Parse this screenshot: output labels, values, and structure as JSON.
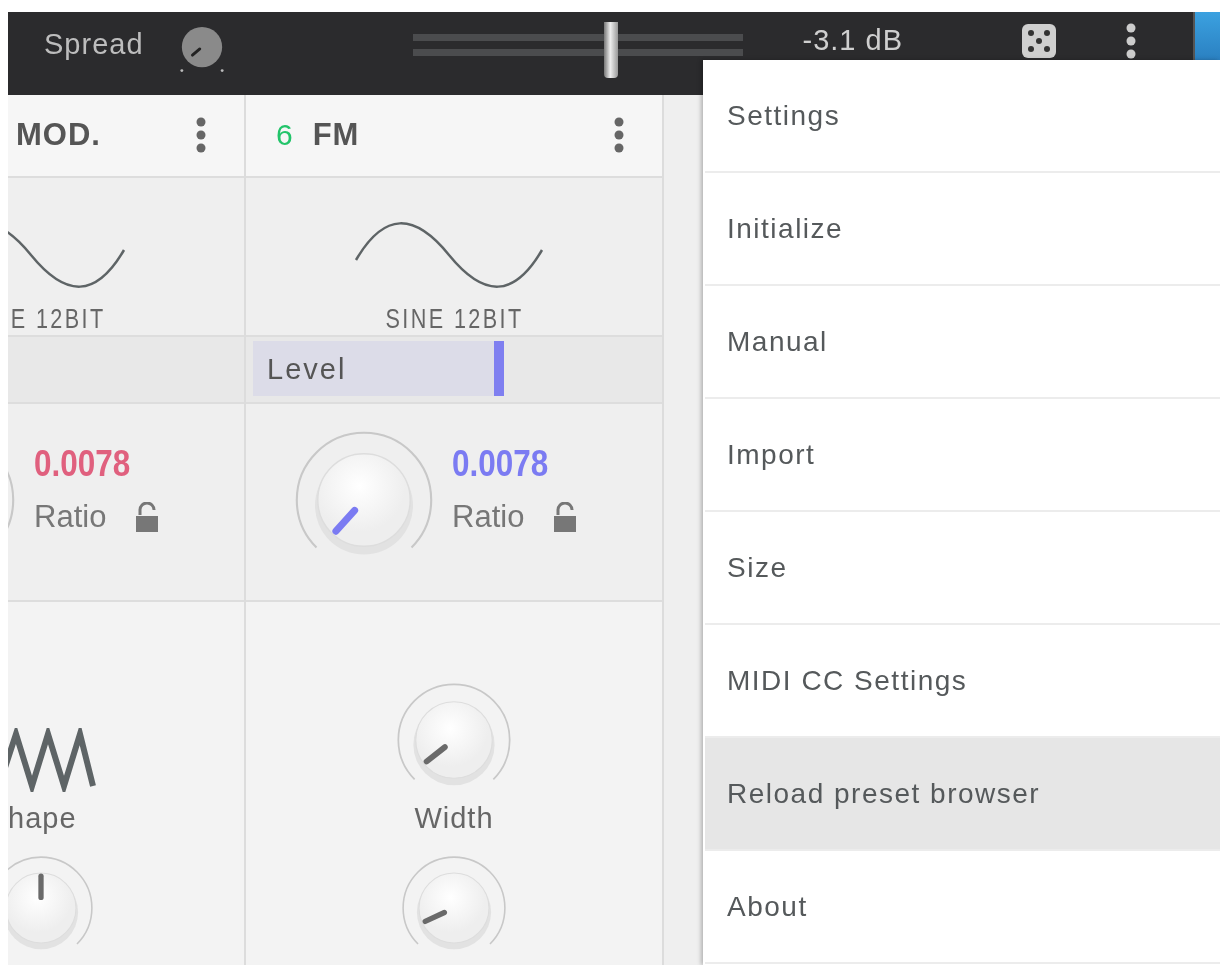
{
  "top_bar": {
    "spread_label": "Spread",
    "volume_slider": {
      "level": 0.6
    },
    "volume_reading": "-3.1 dB"
  },
  "panels": [
    {
      "title": "MOD.",
      "waveform_label": "E 12BIT",
      "value": "0.0078",
      "color": "#e0607e",
      "ratio_label": "Ratio",
      "bottom": {
        "kind": "wave-selector",
        "label": "hape"
      }
    },
    {
      "number": "6",
      "title": "FM",
      "waveform_label": "SINE 12BIT",
      "level_bar": {
        "label": "Level",
        "level": 0.62
      },
      "value": "0.0078",
      "color": "#7b7bf2",
      "ratio_label": "Ratio",
      "bottom": {
        "kind": "knob",
        "label": "Width"
      }
    }
  ],
  "menu": {
    "items": [
      {
        "label": "Settings",
        "selected": false
      },
      {
        "label": "Initialize",
        "selected": false
      },
      {
        "label": "Manual",
        "selected": false
      },
      {
        "label": "Import",
        "selected": false
      },
      {
        "label": "Size",
        "selected": false
      },
      {
        "label": "MIDI CC Settings",
        "selected": false
      },
      {
        "label": "Reload preset browser",
        "selected": true
      },
      {
        "label": "About",
        "selected": false
      }
    ]
  }
}
